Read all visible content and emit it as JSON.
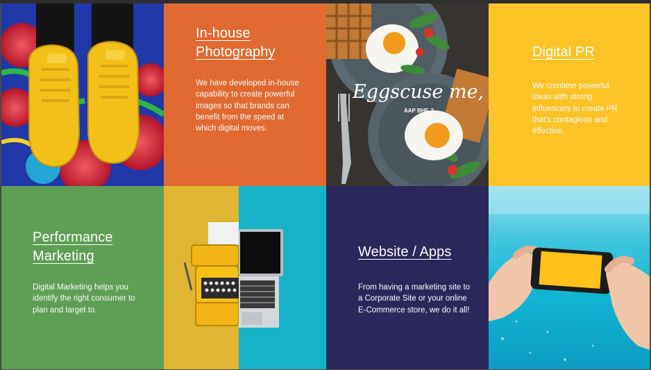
{
  "tiles": {
    "photography": {
      "title_line1": "In-house",
      "title_line2": "Photography",
      "body": "We have developed in-house capability to create powerful images so that brands can benefit from the speed at which digital moves.",
      "background": "#e06a31"
    },
    "digital_pr": {
      "title": "Digital PR",
      "body": "We combine powerful ideas with strong influencers to create PR that's contagious and effective.",
      "background": "#fcc327"
    },
    "performance": {
      "title_line1": "Performance",
      "title_line2": "Marketing",
      "body": "Digital Marketing  helps you identify the right consumer to plan and target to.",
      "background": "#5f9f55"
    },
    "website": {
      "title": "Website / Apps",
      "body": "From having a marketing site to a  Corporate Site or your  online E-Commerce  store, we do it all!",
      "background": "#2a285b"
    }
  },
  "images": {
    "sneakers": {
      "icon": "yellow-sneakers-photo"
    },
    "food": {
      "icon": "eggs-waffles-photo",
      "caption_main": "Eggscuse me,",
      "caption_sub": "AAP BHE ?"
    },
    "typewriter": {
      "icon": "typewriter-laptop-photo",
      "left_color": "#e0b532",
      "right_color": "#16b3c8"
    },
    "sea": {
      "icon": "phone-at-sea-photo"
    }
  }
}
